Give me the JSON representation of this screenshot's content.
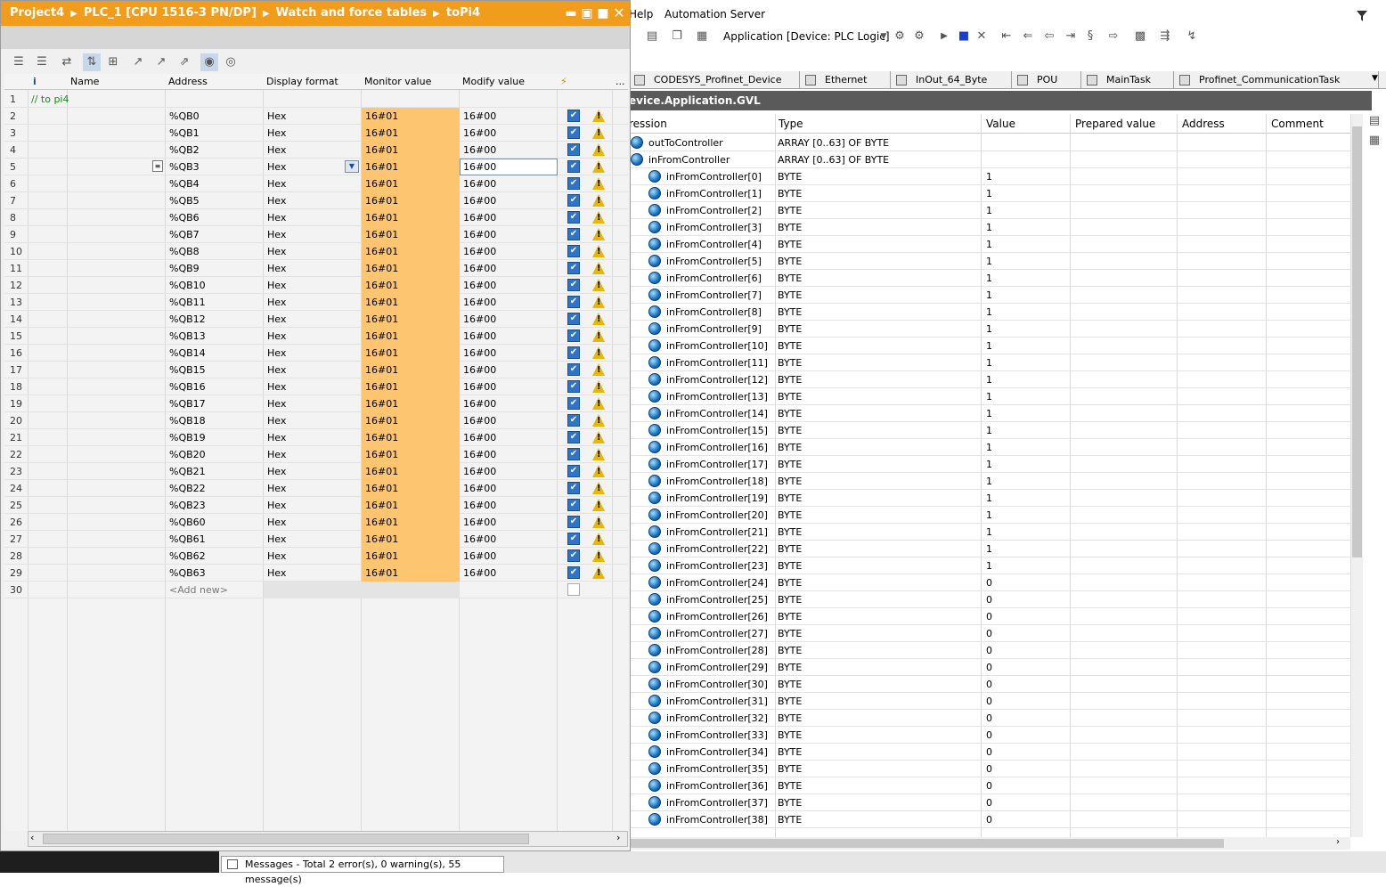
{
  "codesys": {
    "menu": [
      "Help",
      "Automation Server"
    ],
    "application_label": "Application [Device: PLC Logic]",
    "tabs": [
      "CODESYS_Profinet_Device",
      "Ethernet",
      "InOut_64_Byte",
      "POU",
      "MainTask",
      "Profinet_CommunicationTask"
    ],
    "title": "evice.Application.GVL",
    "columns": [
      "ression",
      "Type",
      "Value",
      "Prepared value",
      "Address",
      "Comment"
    ],
    "rows": [
      {
        "name": "outToController",
        "type": "ARRAY [0..63] OF BYTE",
        "value": "",
        "level": 0
      },
      {
        "name": "inFromController",
        "type": "ARRAY [0..63] OF BYTE",
        "value": "",
        "level": 0
      },
      {
        "name": "inFromController[0]",
        "type": "BYTE",
        "value": "1",
        "level": 1
      },
      {
        "name": "inFromController[1]",
        "type": "BYTE",
        "value": "1",
        "level": 1
      },
      {
        "name": "inFromController[2]",
        "type": "BYTE",
        "value": "1",
        "level": 1
      },
      {
        "name": "inFromController[3]",
        "type": "BYTE",
        "value": "1",
        "level": 1
      },
      {
        "name": "inFromController[4]",
        "type": "BYTE",
        "value": "1",
        "level": 1
      },
      {
        "name": "inFromController[5]",
        "type": "BYTE",
        "value": "1",
        "level": 1
      },
      {
        "name": "inFromController[6]",
        "type": "BYTE",
        "value": "1",
        "level": 1
      },
      {
        "name": "inFromController[7]",
        "type": "BYTE",
        "value": "1",
        "level": 1
      },
      {
        "name": "inFromController[8]",
        "type": "BYTE",
        "value": "1",
        "level": 1
      },
      {
        "name": "inFromController[9]",
        "type": "BYTE",
        "value": "1",
        "level": 1
      },
      {
        "name": "inFromController[10]",
        "type": "BYTE",
        "value": "1",
        "level": 1
      },
      {
        "name": "inFromController[11]",
        "type": "BYTE",
        "value": "1",
        "level": 1
      },
      {
        "name": "inFromController[12]",
        "type": "BYTE",
        "value": "1",
        "level": 1
      },
      {
        "name": "inFromController[13]",
        "type": "BYTE",
        "value": "1",
        "level": 1
      },
      {
        "name": "inFromController[14]",
        "type": "BYTE",
        "value": "1",
        "level": 1
      },
      {
        "name": "inFromController[15]",
        "type": "BYTE",
        "value": "1",
        "level": 1
      },
      {
        "name": "inFromController[16]",
        "type": "BYTE",
        "value": "1",
        "level": 1
      },
      {
        "name": "inFromController[17]",
        "type": "BYTE",
        "value": "1",
        "level": 1
      },
      {
        "name": "inFromController[18]",
        "type": "BYTE",
        "value": "1",
        "level": 1
      },
      {
        "name": "inFromController[19]",
        "type": "BYTE",
        "value": "1",
        "level": 1
      },
      {
        "name": "inFromController[20]",
        "type": "BYTE",
        "value": "1",
        "level": 1
      },
      {
        "name": "inFromController[21]",
        "type": "BYTE",
        "value": "1",
        "level": 1
      },
      {
        "name": "inFromController[22]",
        "type": "BYTE",
        "value": "1",
        "level": 1
      },
      {
        "name": "inFromController[23]",
        "type": "BYTE",
        "value": "1",
        "level": 1
      },
      {
        "name": "inFromController[24]",
        "type": "BYTE",
        "value": "0",
        "level": 1
      },
      {
        "name": "inFromController[25]",
        "type": "BYTE",
        "value": "0",
        "level": 1
      },
      {
        "name": "inFromController[26]",
        "type": "BYTE",
        "value": "0",
        "level": 1
      },
      {
        "name": "inFromController[27]",
        "type": "BYTE",
        "value": "0",
        "level": 1
      },
      {
        "name": "inFromController[28]",
        "type": "BYTE",
        "value": "0",
        "level": 1
      },
      {
        "name": "inFromController[29]",
        "type": "BYTE",
        "value": "0",
        "level": 1
      },
      {
        "name": "inFromController[30]",
        "type": "BYTE",
        "value": "0",
        "level": 1
      },
      {
        "name": "inFromController[31]",
        "type": "BYTE",
        "value": "0",
        "level": 1
      },
      {
        "name": "inFromController[32]",
        "type": "BYTE",
        "value": "0",
        "level": 1
      },
      {
        "name": "inFromController[33]",
        "type": "BYTE",
        "value": "0",
        "level": 1
      },
      {
        "name": "inFromController[34]",
        "type": "BYTE",
        "value": "0",
        "level": 1
      },
      {
        "name": "inFromController[35]",
        "type": "BYTE",
        "value": "0",
        "level": 1
      },
      {
        "name": "inFromController[36]",
        "type": "BYTE",
        "value": "0",
        "level": 1
      },
      {
        "name": "inFromController[37]",
        "type": "BYTE",
        "value": "0",
        "level": 1
      },
      {
        "name": "inFromController[38]",
        "type": "BYTE",
        "value": "0",
        "level": 1
      }
    ]
  },
  "tia": {
    "breadcrumb": [
      "Project4",
      "PLC_1 [CPU 1516-3 PN/DP]",
      "Watch and force tables",
      "toPi4"
    ],
    "columns": {
      "info": "i",
      "name": "Name",
      "address": "Address",
      "format": "Display format",
      "monitor": "Monitor value",
      "modify": "Modify value",
      "more": "..."
    },
    "comment_row": {
      "num": "1",
      "text": "// to pi4"
    },
    "rows": [
      {
        "num": "2",
        "address": "%QB0",
        "format": "Hex",
        "monitor": "16#01",
        "modify": "16#00"
      },
      {
        "num": "3",
        "address": "%QB1",
        "format": "Hex",
        "monitor": "16#01",
        "modify": "16#00"
      },
      {
        "num": "4",
        "address": "%QB2",
        "format": "Hex",
        "monitor": "16#01",
        "modify": "16#00"
      },
      {
        "num": "5",
        "address": "%QB3",
        "format": "Hex",
        "monitor": "16#01",
        "modify": "16#00",
        "selected": true
      },
      {
        "num": "6",
        "address": "%QB4",
        "format": "Hex",
        "monitor": "16#01",
        "modify": "16#00"
      },
      {
        "num": "7",
        "address": "%QB5",
        "format": "Hex",
        "monitor": "16#01",
        "modify": "16#00"
      },
      {
        "num": "8",
        "address": "%QB6",
        "format": "Hex",
        "monitor": "16#01",
        "modify": "16#00"
      },
      {
        "num": "9",
        "address": "%QB7",
        "format": "Hex",
        "monitor": "16#01",
        "modify": "16#00"
      },
      {
        "num": "10",
        "address": "%QB8",
        "format": "Hex",
        "monitor": "16#01",
        "modify": "16#00"
      },
      {
        "num": "11",
        "address": "%QB9",
        "format": "Hex",
        "monitor": "16#01",
        "modify": "16#00"
      },
      {
        "num": "12",
        "address": "%QB10",
        "format": "Hex",
        "monitor": "16#01",
        "modify": "16#00"
      },
      {
        "num": "13",
        "address": "%QB11",
        "format": "Hex",
        "monitor": "16#01",
        "modify": "16#00"
      },
      {
        "num": "14",
        "address": "%QB12",
        "format": "Hex",
        "monitor": "16#01",
        "modify": "16#00"
      },
      {
        "num": "15",
        "address": "%QB13",
        "format": "Hex",
        "monitor": "16#01",
        "modify": "16#00"
      },
      {
        "num": "16",
        "address": "%QB14",
        "format": "Hex",
        "monitor": "16#01",
        "modify": "16#00"
      },
      {
        "num": "17",
        "address": "%QB15",
        "format": "Hex",
        "monitor": "16#01",
        "modify": "16#00"
      },
      {
        "num": "18",
        "address": "%QB16",
        "format": "Hex",
        "monitor": "16#01",
        "modify": "16#00"
      },
      {
        "num": "19",
        "address": "%QB17",
        "format": "Hex",
        "monitor": "16#01",
        "modify": "16#00"
      },
      {
        "num": "20",
        "address": "%QB18",
        "format": "Hex",
        "monitor": "16#01",
        "modify": "16#00"
      },
      {
        "num": "21",
        "address": "%QB19",
        "format": "Hex",
        "monitor": "16#01",
        "modify": "16#00"
      },
      {
        "num": "22",
        "address": "%QB20",
        "format": "Hex",
        "monitor": "16#01",
        "modify": "16#00"
      },
      {
        "num": "23",
        "address": "%QB21",
        "format": "Hex",
        "monitor": "16#01",
        "modify": "16#00"
      },
      {
        "num": "24",
        "address": "%QB22",
        "format": "Hex",
        "monitor": "16#01",
        "modify": "16#00"
      },
      {
        "num": "25",
        "address": "%QB23",
        "format": "Hex",
        "monitor": "16#01",
        "modify": "16#00"
      },
      {
        "num": "26",
        "address": "%QB60",
        "format": "Hex",
        "monitor": "16#01",
        "modify": "16#00"
      },
      {
        "num": "27",
        "address": "%QB61",
        "format": "Hex",
        "monitor": "16#01",
        "modify": "16#00"
      },
      {
        "num": "28",
        "address": "%QB62",
        "format": "Hex",
        "monitor": "16#01",
        "modify": "16#00"
      },
      {
        "num": "29",
        "address": "%QB63",
        "format": "Hex",
        "monitor": "16#01",
        "modify": "16#00"
      }
    ],
    "add_row": {
      "num": "30",
      "text": "<Add new>"
    }
  },
  "messages": {
    "text": "Messages - Total 2 error(s), 0 warning(s), 55 message(s)"
  },
  "colors": {
    "tia_title": "#f29c1c",
    "monitor_cell": "#fdc570",
    "checkbox": "#2f74c9",
    "warning": "#e8b800",
    "comment": "#1a8a1a"
  }
}
